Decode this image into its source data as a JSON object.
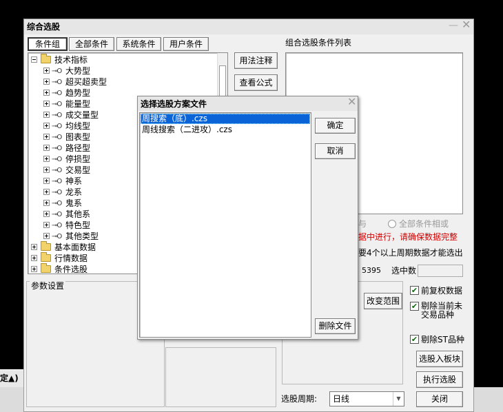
{
  "main_window": {
    "title": "综合选股",
    "tabs": [
      "条件组",
      "全部条件",
      "系统条件",
      "用户条件"
    ],
    "tree": [
      {
        "label": "技术指标",
        "type": "folder",
        "level": 0,
        "expanded": true
      },
      {
        "label": "大势型",
        "type": "item",
        "level": 1
      },
      {
        "label": "超买超卖型",
        "type": "item",
        "level": 1
      },
      {
        "label": "趋势型",
        "type": "item",
        "level": 1
      },
      {
        "label": "能量型",
        "type": "item",
        "level": 1
      },
      {
        "label": "成交量型",
        "type": "item",
        "level": 1
      },
      {
        "label": "均线型",
        "type": "item",
        "level": 1
      },
      {
        "label": "图表型",
        "type": "item",
        "level": 1
      },
      {
        "label": "路径型",
        "type": "item",
        "level": 1
      },
      {
        "label": "停损型",
        "type": "item",
        "level": 1
      },
      {
        "label": "交易型",
        "type": "item",
        "level": 1
      },
      {
        "label": "神系",
        "type": "item",
        "level": 1
      },
      {
        "label": "龙系",
        "type": "item",
        "level": 1
      },
      {
        "label": "鬼系",
        "type": "item",
        "level": 1
      },
      {
        "label": "其他系",
        "type": "item",
        "level": 1
      },
      {
        "label": "特色型",
        "type": "item",
        "level": 1
      },
      {
        "label": "其他类型",
        "type": "item",
        "level": 1
      },
      {
        "label": "基本面数据",
        "type": "folder",
        "level": 0,
        "expanded": false
      },
      {
        "label": "行情数据",
        "type": "folder",
        "level": 0,
        "expanded": false
      },
      {
        "label": "条件选股",
        "type": "folder",
        "level": 0,
        "expanded": false
      }
    ],
    "buttons": {
      "usage_note": "用法注释",
      "view_formula": "查看公式",
      "change_range": "改变范围",
      "select_to_block": "选股入板块",
      "execute": "执行选股",
      "close": "关闭"
    },
    "list_title": "组合选股条件列表",
    "radio_and_partial": "与",
    "radio_all_or": "全部条件相或",
    "warning_text": "据中进行，请确保数据完整",
    "info_text": "要4个以上周期数据才能选出",
    "count_value": "5395",
    "selected_label": "选中数",
    "param_group_title": "参数设置",
    "checkboxes": [
      {
        "label_line1": "前复权数据",
        "label_line2": "",
        "checked": true
      },
      {
        "label_line1": "剔除当前未",
        "label_line2": "交易品种",
        "checked": true
      },
      {
        "label_line1": "剔除ST品种",
        "label_line2": "",
        "checked": true
      }
    ],
    "period_label": "选股周期:",
    "period_value": "日线",
    "left_edge_text": "定▲)"
  },
  "file_dialog": {
    "title": "选择选股方案文件",
    "files": [
      {
        "name": "周搜索（底）.czs",
        "selected": true
      },
      {
        "name": "周线搜索（二进攻）.czs",
        "selected": false
      }
    ],
    "ok": "确定",
    "cancel": "取消",
    "delete": "删除文件"
  },
  "icons": {
    "close": "close-icon",
    "minimize": "minimize-icon",
    "folder": "folder-icon",
    "key": "key-icon"
  },
  "colors": {
    "selection": "#0a64d8",
    "warning": "#d40000",
    "window_bg": "#f0f0f0"
  }
}
